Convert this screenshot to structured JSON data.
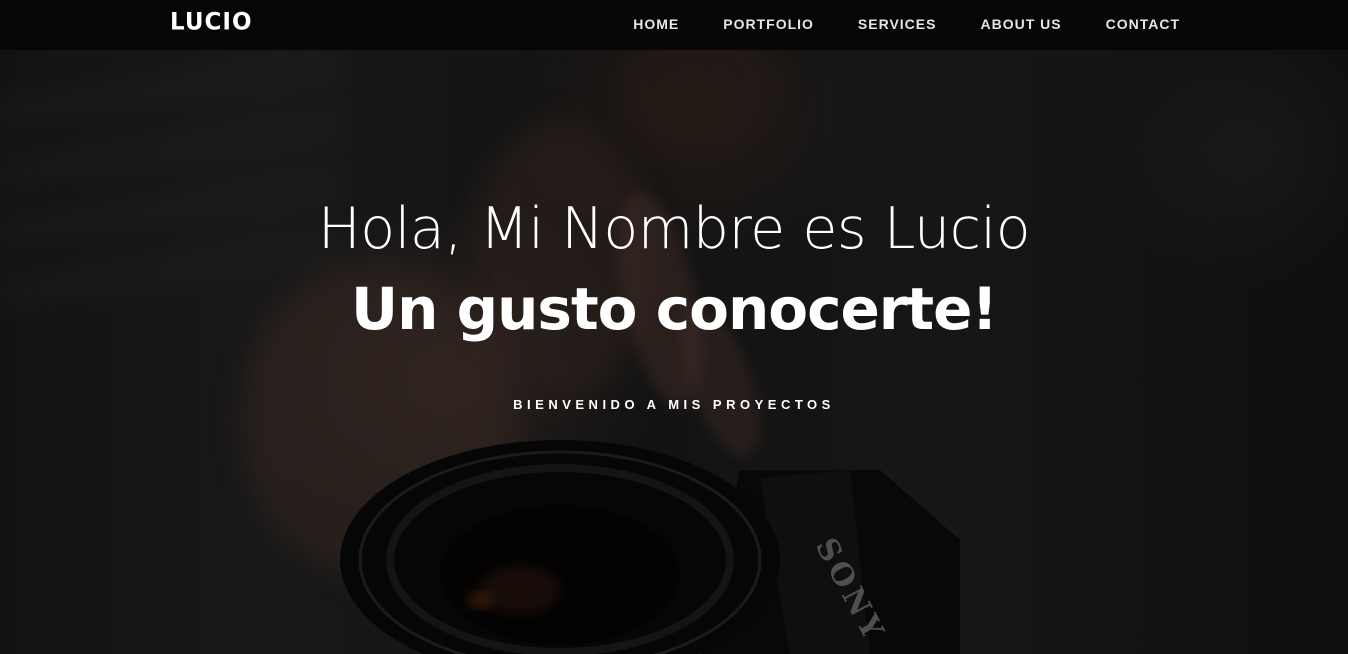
{
  "brand": {
    "name": "LUCIO"
  },
  "nav": {
    "items": [
      {
        "label": "HOME"
      },
      {
        "label": "PORTFOLIO"
      },
      {
        "label": "SERVICES"
      },
      {
        "label": "ABOUT US"
      },
      {
        "label": "CONTACT"
      }
    ]
  },
  "hero": {
    "heading_light": "Hola, Mi Nombre es Lucio",
    "heading_bold": "Un gusto conocerte!",
    "tagline": "BIENVENIDO A MIS PROYECTOS",
    "background_image_icon": "camera-photo",
    "camera_brand_text": "SONY"
  },
  "colors": {
    "navbar_bg": "#060606",
    "text": "#ffffff",
    "nav_text": "#e6e6e6"
  }
}
